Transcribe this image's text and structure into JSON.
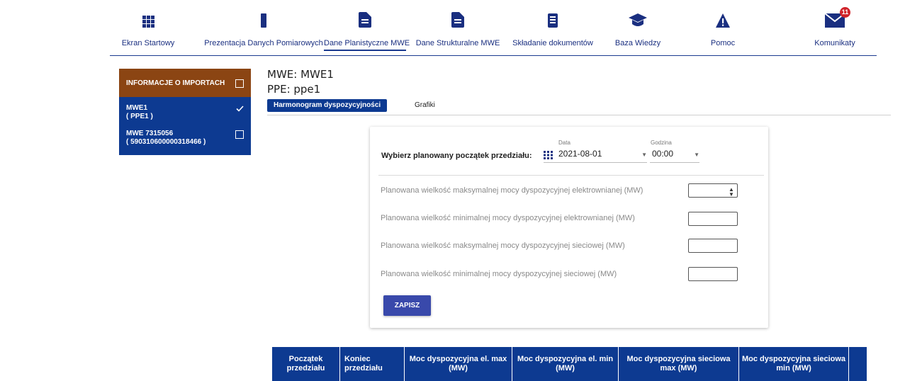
{
  "nav": {
    "items": [
      {
        "label": "Ekran Startowy",
        "icon": "grid-icon"
      },
      {
        "label": "Prezentacja Danych Pomiarowych",
        "icon": "bar-icon"
      },
      {
        "label": "Dane Planistyczne MWE",
        "icon": "document-icon"
      },
      {
        "label": "Dane Strukturalne MWE",
        "icon": "document-icon"
      },
      {
        "label": "Składanie dokumentów",
        "icon": "list-document-icon"
      },
      {
        "label": "Baza Wiedzy",
        "icon": "graduation-cap-icon"
      },
      {
        "label": "Pomoc",
        "icon": "warning-icon"
      },
      {
        "label": "Komunikaty",
        "icon": "envelope-icon",
        "badge": "11"
      }
    ],
    "active": "Dane Planistyczne MWE",
    "accent": "#1a2f80"
  },
  "sidebar": {
    "header": "INFORMACJE O IMPORTACH",
    "header_color": "#8b4513",
    "list_color": "#0d3a91",
    "items": [
      {
        "line1": "MWE1",
        "line2": "( PPE1 )",
        "checked": true
      },
      {
        "line1": "MWE 7315056",
        "line2": "( 590310600000318466 )",
        "checked": false
      }
    ]
  },
  "heading": {
    "mwe": "MWE: MWE1",
    "ppe": "PPE: ppe1"
  },
  "tabs": [
    {
      "label": "Harmonogram dyspozycyjności",
      "active": true
    },
    {
      "label": "Grafiki",
      "active": false
    }
  ],
  "form": {
    "pick_label": "Wybierz planowany początek przedziału:",
    "date_caption": "Data",
    "date_value": "2021-08-01",
    "time_caption": "Godzina",
    "time_value": "00:00",
    "rows": [
      {
        "label": "Planowana wielkość maksymalnej mocy dyspozycyjnej elektrownianej (MW)",
        "value": ""
      },
      {
        "label": "Planowana wielkość minimalnej mocy dyspozycyjnej elektrownianej (MW)",
        "value": ""
      },
      {
        "label": "Planowana wielkość maksymalnej mocy dyspozycyjnej sieciowej (MW)",
        "value": ""
      },
      {
        "label": "Planowana wielkość minimalnej mocy dyspozycyjnej sieciowej (MW)",
        "value": ""
      }
    ],
    "save_label": "ZAPISZ",
    "save_color": "#3949ab"
  },
  "table": {
    "header_color": "#0d3a91",
    "columns": [
      "Początek przedziału",
      "Koniec przedziału",
      "Moc dyspozycyjna el. max (MW)",
      "Moc dyspozycyjna el. min (MW)",
      "Moc dyspozycyjna sieciowa max (MW)",
      "Moc dyspozycyjna sieciowa min (MW)",
      ""
    ]
  }
}
